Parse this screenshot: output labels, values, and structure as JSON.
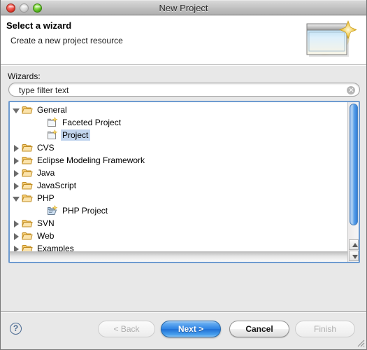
{
  "window": {
    "title": "New Project",
    "traffic_lights": [
      {
        "name": "close-button",
        "color": "#d62e22"
      },
      {
        "name": "minimize-button",
        "color": "#bdbdbd"
      },
      {
        "name": "zoom-button",
        "color": "#45a614"
      }
    ]
  },
  "header": {
    "title": "Select a wizard",
    "subtitle": "Create a new project resource",
    "banner_icon": "wizard-sparkle-window-icon"
  },
  "main": {
    "wizards_label": "Wizards:",
    "filter": {
      "value": "type filter text",
      "placeholder": "type filter text",
      "clear_icon": "clear-circle-icon"
    },
    "tree": {
      "selected": "Project",
      "nodes": [
        {
          "label": "General",
          "level": 1,
          "expandable": true,
          "expanded": true,
          "icon": "open-folder-icon",
          "selected": false
        },
        {
          "label": "Faceted Project",
          "level": 2,
          "expandable": false,
          "expanded": false,
          "icon": "new-project-icon",
          "selected": false
        },
        {
          "label": "Project",
          "level": 2,
          "expandable": false,
          "expanded": false,
          "icon": "new-project-icon",
          "selected": true
        },
        {
          "label": "CVS",
          "level": 1,
          "expandable": true,
          "expanded": false,
          "icon": "open-folder-icon",
          "selected": false
        },
        {
          "label": "Eclipse Modeling Framework",
          "level": 1,
          "expandable": true,
          "expanded": false,
          "icon": "open-folder-icon",
          "selected": false
        },
        {
          "label": "Java",
          "level": 1,
          "expandable": true,
          "expanded": false,
          "icon": "open-folder-icon",
          "selected": false
        },
        {
          "label": "JavaScript",
          "level": 1,
          "expandable": true,
          "expanded": false,
          "icon": "open-folder-icon",
          "selected": false
        },
        {
          "label": "PHP",
          "level": 1,
          "expandable": true,
          "expanded": true,
          "icon": "open-folder-icon",
          "selected": false
        },
        {
          "label": "PHP Project",
          "level": 2,
          "expandable": false,
          "expanded": false,
          "icon": "php-project-icon",
          "selected": false
        },
        {
          "label": "SVN",
          "level": 1,
          "expandable": true,
          "expanded": false,
          "icon": "open-folder-icon",
          "selected": false
        },
        {
          "label": "Web",
          "level": 1,
          "expandable": true,
          "expanded": false,
          "icon": "open-folder-icon",
          "selected": false
        },
        {
          "label": "Examples",
          "level": 1,
          "expandable": true,
          "expanded": false,
          "icon": "open-folder-icon",
          "selected": false
        }
      ]
    },
    "scrollbars": {
      "vertical_up_icon": "scroll-up-arrow-icon",
      "vertical_down_icon": "scroll-down-arrow-icon"
    }
  },
  "footer": {
    "help_label": "?",
    "buttons": [
      {
        "name": "back-button",
        "label": "< Back",
        "state": "disabled"
      },
      {
        "name": "next-button",
        "label": "Next >",
        "state": "default"
      },
      {
        "name": "cancel-button",
        "label": "Cancel",
        "state": "normal"
      },
      {
        "name": "finish-button",
        "label": "Finish",
        "state": "disabled"
      }
    ],
    "resize_grip_icon": "resize-grip-icon"
  },
  "colors": {
    "accent_blue": "#2d83e4",
    "selection_blue": "#c2d5ee",
    "folder_orange": "#e8a33d",
    "window_bg": "#e8e8e8"
  }
}
